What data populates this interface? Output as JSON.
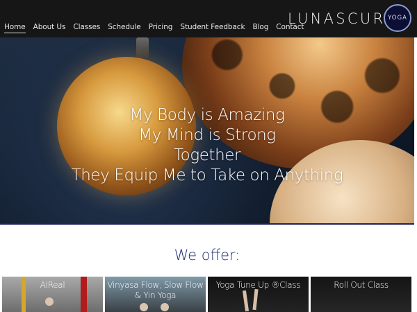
{
  "nav": {
    "items": [
      "Home",
      "About Us",
      "Classes",
      "Schedule",
      "Pricing",
      "Student Feedback",
      "Blog",
      "Contact"
    ],
    "active": "Home"
  },
  "logo": {
    "text": "LUNASCURA",
    "badge": "YOGA"
  },
  "hero": {
    "lines": [
      "My Body is Amazing",
      "My Mind is Strong",
      "Together",
      "They Equip Me to Take on Anything"
    ]
  },
  "offer": {
    "heading": "We offer:",
    "cards": [
      {
        "title": "AIReal"
      },
      {
        "title": "Vinyasa Flow, Slow Flow & Yin Yoga"
      },
      {
        "title": "Yoga Tune Up ®Class"
      },
      {
        "title": "Roll Out Class"
      }
    ]
  },
  "colors": {
    "header_bg": "#161616",
    "accent_navy": "#1e2d70",
    "logo_ring": "#8e9bd0"
  }
}
